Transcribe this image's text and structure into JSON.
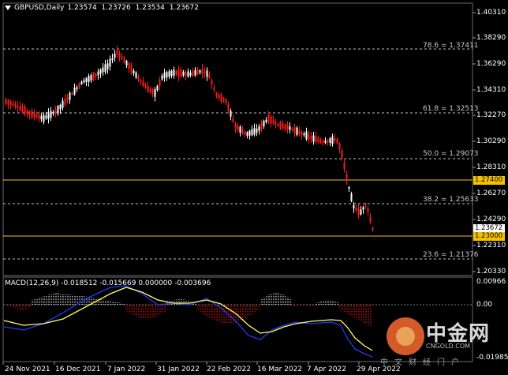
{
  "header": {
    "symbol": "GBPUSD,Daily",
    "open": "1.23574",
    "high": "1.23726",
    "low": "1.23534",
    "close": "1.23672"
  },
  "price_axis": [
    "1.40310",
    "1.38290",
    "1.36290",
    "1.34310",
    "1.32270",
    "1.30290",
    "1.28310",
    "1.26270",
    "1.24290",
    "1.22310",
    "1.20330"
  ],
  "fib_levels": [
    "78.6 = 1.37411",
    "61.8 = 1.32513",
    "50.0 = 1.29073",
    "38.2 = 1.25633",
    "23.6 = 1.21376"
  ],
  "tags": {
    "level_high": "1.27400",
    "current": "1.23672",
    "level_low": "1.23000"
  },
  "macd": {
    "title": "MACD(12,26,9) -0.018512 -0.015669 0.000000 -0.003696",
    "axis": [
      "0.00966",
      "0.00",
      "-0.01985"
    ]
  },
  "time_axis": [
    "24 Nov 2021",
    "16 Dec 2021",
    "7 Jan 2022",
    "31 Jan 2022",
    "22 Feb 2022",
    "16 Mar 2022",
    "7 Apr 2022",
    "29 Apr 2022"
  ],
  "watermark": {
    "cn": "中金网",
    "en": "CNGOLD.COM",
    "sub": "中文财经门户"
  },
  "colors": {
    "bull": "#ffffff",
    "bear": "#ff1a1a",
    "level_line": "#f2c200",
    "signal": "#ffff66",
    "macd_line": "#1e3cff",
    "grid": "#c8c8c8"
  }
}
